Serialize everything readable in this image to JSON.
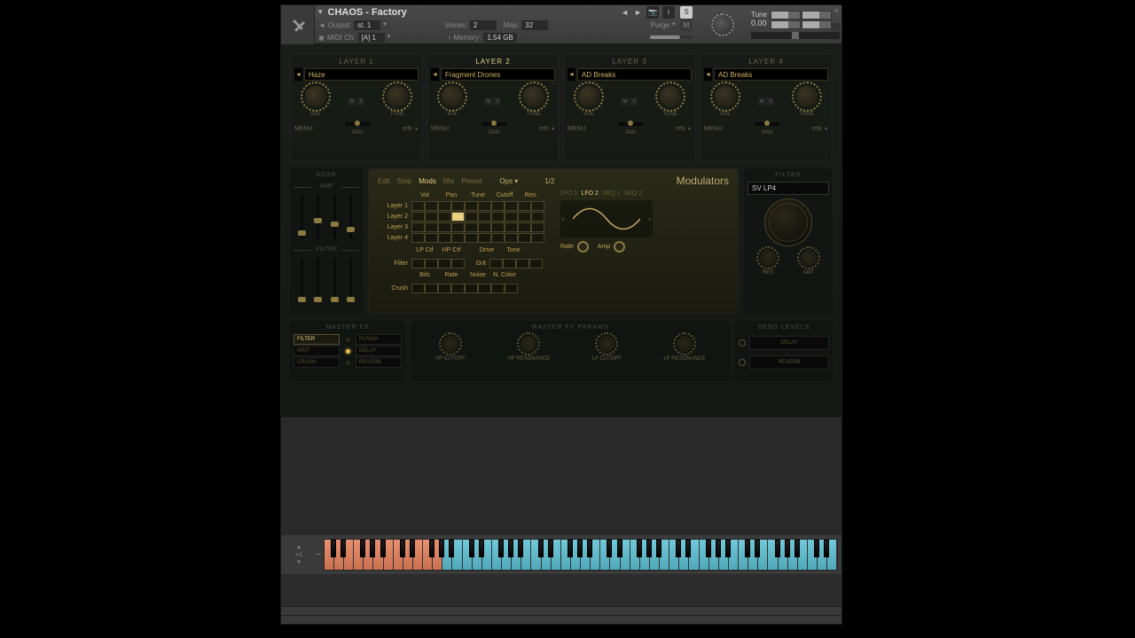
{
  "header": {
    "patch_name": "CHAOS - Factory",
    "output_label": "Output:",
    "output_value": "st. 1",
    "midi_label": "MIDI Ch:",
    "midi_value": "[A] 1",
    "voices_label": "Voices:",
    "voices_value": "2",
    "max_label": "Max:",
    "max_value": "32",
    "memory_label": "Memory:",
    "memory_value": "1.54 GB",
    "purge_label": "Purge",
    "s_button": "S",
    "m_button": "M",
    "tune_label": "Tune",
    "tune_value": "0.00",
    "close": "×"
  },
  "layers": [
    {
      "title": "LAYER 1",
      "preset": "Haze",
      "vol": "VOL",
      "tune": "TUNE",
      "menu": "MENU",
      "pan": "PAN",
      "mfx": "mfx",
      "active": false
    },
    {
      "title": "LAYER 2",
      "preset": "Fragment Drones",
      "vol": "VOL",
      "tune": "TUNE",
      "menu": "MENU",
      "pan": "PAN",
      "mfx": "mfx",
      "active": true
    },
    {
      "title": "LAYER 3",
      "preset": "AD Breaks",
      "vol": "VOL",
      "tune": "TUNE",
      "menu": "MENU",
      "pan": "PAN",
      "mfx": "mfx",
      "active": false
    },
    {
      "title": "LAYER 4",
      "preset": "AD Breaks",
      "vol": "VOL",
      "tune": "TUNE",
      "menu": "MENU",
      "pan": "PAN",
      "mfx": "mfx",
      "active": false
    }
  ],
  "amp": {
    "title": "ADSR",
    "amp_label": "AMP",
    "filter_label": "FILTER"
  },
  "mods": {
    "tabs": {
      "edit": "Edit",
      "step": "Step",
      "mods": "Mods",
      "mix": "Mix",
      "preset": "Preset"
    },
    "active_tab": "Mods",
    "ops": "Ops",
    "page": "1/2",
    "title": "Modulators",
    "cols": [
      "Vol",
      "Pan",
      "Tune",
      "Cutoff",
      "Res."
    ],
    "rows": [
      "Layer 1",
      "Layer 2",
      "Layer 3",
      "Layer 4"
    ],
    "selected": {
      "row": 1,
      "col": 1
    },
    "sub1_cols": [
      "LP Ctf",
      "HP Ctf"
    ],
    "sub1_row": "Filter",
    "sub1b_cols": [
      "Drive",
      "Tone"
    ],
    "sub1b_row": "Grit",
    "sub2_cols": [
      "Bits",
      "Rate",
      "Noise",
      "N. Color"
    ],
    "sub2_row": "Crush",
    "lfo_tabs": [
      "LFO 1",
      "LFO 2",
      "SEQ 1",
      "SEQ 2"
    ],
    "lfo_active": "LFO 2",
    "rate_label": "Rate",
    "amp_label": "Amp"
  },
  "filter": {
    "title": "FILTER",
    "type": "SV LP4",
    "res_label": "RES",
    "amt_label": "AMT"
  },
  "fx": {
    "left_title": "MASTER FX",
    "buttons": [
      {
        "l": "FILTER",
        "r": "PUNCH",
        "l_active": true
      },
      {
        "l": "GRIT",
        "r": "DELAY"
      },
      {
        "l": "CRUSH",
        "r": "REVERB"
      }
    ],
    "params_title": "MASTER FX PARAMS",
    "knobs": [
      "HP CUTOFF",
      "HP RESONANCE",
      "LP CUTOFF",
      "LP RESONANCE"
    ],
    "send_title": "SEND LEVELS",
    "sends": [
      "DELAY",
      "REVERB"
    ]
  },
  "keyboard": {
    "plus1": "+1",
    "minus": "−"
  }
}
